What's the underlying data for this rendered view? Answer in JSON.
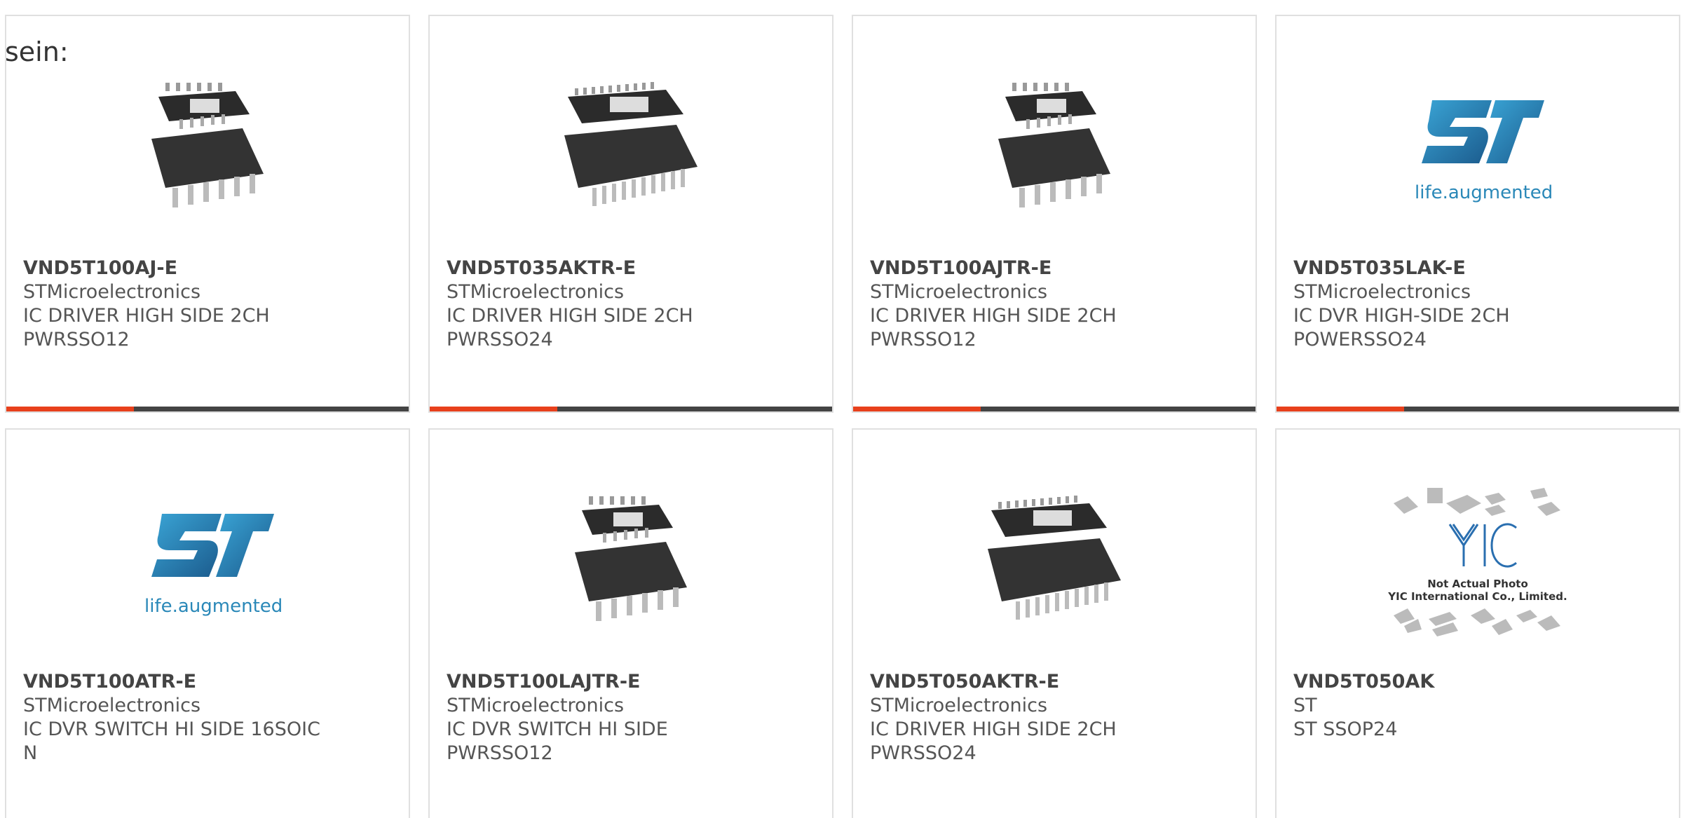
{
  "intro_text": "sein:",
  "colors": {
    "accent": "#e8401c",
    "bar_dark": "#444444",
    "st_blue": "#2a88b8"
  },
  "products": [
    {
      "part": "VND5T100AJ-E",
      "maker": "STMicroelectronics",
      "desc1": "IC DRIVER HIGH SIDE 2CH",
      "desc2": "PWRSSO12",
      "image": "chip-12pin"
    },
    {
      "part": "VND5T035AKTR-E",
      "maker": "STMicroelectronics",
      "desc1": "IC DRIVER HIGH SIDE 2CH",
      "desc2": "PWRSSO24",
      "image": "chip-24pin"
    },
    {
      "part": "VND5T100AJTR-E",
      "maker": "STMicroelectronics",
      "desc1": "IC DRIVER HIGH SIDE 2CH",
      "desc2": "PWRSSO12",
      "image": "chip-12pin"
    },
    {
      "part": "VND5T035LAK-E",
      "maker": "STMicroelectronics",
      "desc1": "IC DVR HIGH-SIDE 2CH",
      "desc2": "POWERSSO24",
      "image": "st-logo",
      "logo_text": "life.augmented"
    },
    {
      "part": "VND5T100ATR-E",
      "maker": "STMicroelectronics",
      "desc1": "IC DVR SWITCH HI SIDE 16SOIC",
      "desc2": "N",
      "image": "st-logo",
      "logo_text": "life.augmented"
    },
    {
      "part": "VND5T100LAJTR-E",
      "maker": "STMicroelectronics",
      "desc1": "IC DVR SWITCH HI SIDE",
      "desc2": "PWRSSO12",
      "image": "chip-12pin"
    },
    {
      "part": "VND5T050AKTR-E",
      "maker": "STMicroelectronics",
      "desc1": "IC DRIVER HIGH SIDE 2CH",
      "desc2": "PWRSSO24",
      "image": "chip-24pin"
    },
    {
      "part": "VND5T050AK",
      "maker": "ST",
      "desc1": "ST SSOP24",
      "desc2": "",
      "image": "yic-placeholder",
      "logo_line1": "Not Actual Photo",
      "logo_line2": "YIC International Co., Limited."
    }
  ]
}
